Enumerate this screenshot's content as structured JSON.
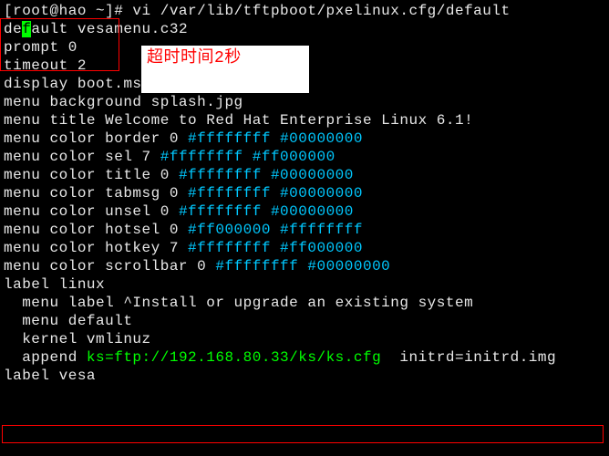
{
  "prompt": "[root@hao ~]# ",
  "command": "vi /var/lib/tftpboot/pxelinux.cfg/default",
  "cursor_pre": "de",
  "cursor_char": "f",
  "cursor_post": "ault vesamenu.c32",
  "box1_l1": "prompt 0",
  "box1_l2": "timeout 2",
  "label_text": "超时时间2秒",
  "blank": "",
  "l_display": "display boot.msg",
  "l_bg": "menu background splash.jpg",
  "l_title": "menu title Welcome to Red Hat Enterprise Linux 6.1!",
  "mc_border_a": "menu color border 0 ",
  "mc_border_b": "#ffffffff #00000000",
  "mc_sel_a": "menu color sel 7 ",
  "mc_sel_b": "#ffffffff #ff000000",
  "mc_title2_a": "menu color title 0 ",
  "mc_title2_b": "#ffffffff #00000000",
  "mc_tabmsg_a": "menu color tabmsg 0 ",
  "mc_tabmsg_b": "#ffffffff #00000000",
  "mc_unsel_a": "menu color unsel 0 ",
  "mc_unsel_b": "#ffffffff #00000000",
  "mc_hotsel_a": "menu color hotsel 0 ",
  "mc_hotsel_b": "#ff000000 #ffffffff",
  "mc_hotkey_a": "menu color hotkey 7 ",
  "mc_hotkey_b": "#ffffffff #ff000000",
  "mc_scroll_a": "menu color scrollbar 0 ",
  "mc_scroll_b": "#ffffffff #00000000",
  "label_linux": "label linux",
  "menu_label": "  menu label ^Install or upgrade an existing system",
  "menu_default": "  menu default",
  "kernel": "  kernel vmlinuz",
  "append_a": "  append ",
  "append_b": "ks=ftp://192.168.80.33/ks/ks.cfg",
  "append_c": "  initrd=initrd.img",
  "label_vesa": "label vesa"
}
